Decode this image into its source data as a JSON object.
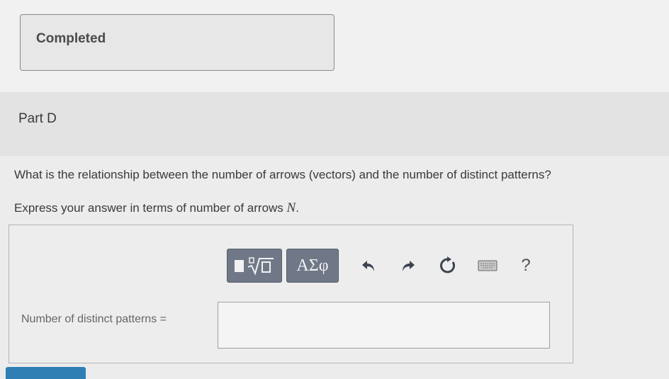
{
  "status": {
    "completed_label": "Completed"
  },
  "part": {
    "title": "Part D"
  },
  "question": {
    "text": "What is the relationship between the number of arrows (vectors) and the number of distinct patterns?",
    "instruction_prefix": "Express your answer in terms of number of arrows ",
    "instruction_variable": "N",
    "instruction_suffix": "."
  },
  "toolbar": {
    "template_icon": "radical-template-icon",
    "greek_label": "ΑΣφ",
    "undo_icon": "undo-icon",
    "redo_icon": "redo-icon",
    "reset_icon": "reset-icon",
    "keyboard_icon": "keyboard-icon",
    "help_label": "?"
  },
  "answer": {
    "label": "Number of distinct patterns =",
    "value": ""
  },
  "colors": {
    "toolbar_button": "#707888",
    "submit_button": "#2f7fb5"
  }
}
